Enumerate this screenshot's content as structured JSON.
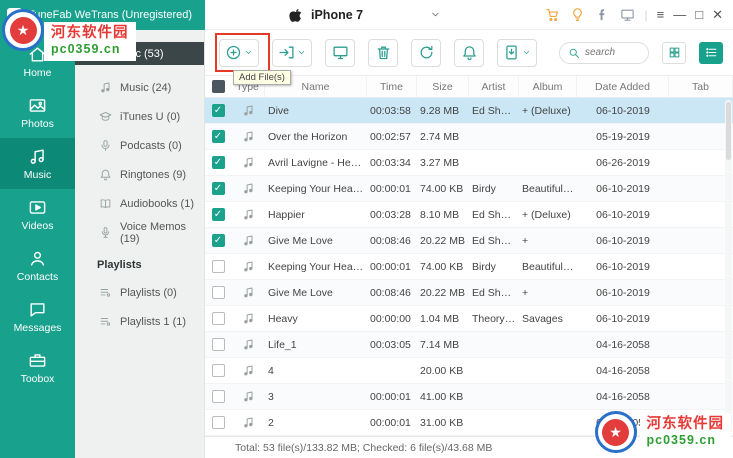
{
  "window": {
    "title": "TuneFab WeTrans (Unregistered)",
    "device": "iPhone 7"
  },
  "sidebar": {
    "items": [
      {
        "label": "Home",
        "icon": "home",
        "active": false
      },
      {
        "label": "Photos",
        "icon": "photos",
        "active": false
      },
      {
        "label": "Music",
        "icon": "music",
        "active": true
      },
      {
        "label": "Videos",
        "icon": "videos",
        "active": false
      },
      {
        "label": "Contacts",
        "icon": "contacts",
        "active": false
      },
      {
        "label": "Messages",
        "icon": "messages",
        "active": false
      },
      {
        "label": "Toobox",
        "icon": "toolbox",
        "active": false
      }
    ]
  },
  "library": {
    "header": "All Music (53)",
    "items": [
      {
        "label": "Music (24)",
        "icon": "note"
      },
      {
        "label": "iTunes U (0)",
        "icon": "itunes-u"
      },
      {
        "label": "Podcasts (0)",
        "icon": "podcast"
      },
      {
        "label": "Ringtones (9)",
        "icon": "ringtone"
      },
      {
        "label": "Audiobooks (1)",
        "icon": "audiobook"
      },
      {
        "label": "Voice Memos (19)",
        "icon": "voice-memo"
      }
    ],
    "playlists_header": "Playlists",
    "playlists": [
      {
        "label": "Playlists (0)",
        "icon": "playlist"
      },
      {
        "label": "Playlists 1 (1)",
        "icon": "playlist"
      }
    ]
  },
  "toolbar": {
    "buttons": [
      {
        "name": "add-file",
        "icon": "add-circle",
        "has_chevron": true
      },
      {
        "name": "export",
        "icon": "export",
        "has_chevron": true
      },
      {
        "name": "transfer-to-device",
        "icon": "monitor",
        "has_chevron": false
      },
      {
        "name": "delete",
        "icon": "trash",
        "has_chevron": false
      },
      {
        "name": "refresh",
        "icon": "sync",
        "has_chevron": false
      },
      {
        "name": "ringtone-maker",
        "icon": "bell",
        "has_chevron": false
      },
      {
        "name": "backup",
        "icon": "backup",
        "has_chevron": true
      }
    ],
    "tooltip": "Add File(s)",
    "search_placeholder": "search"
  },
  "table": {
    "columns": [
      "Type",
      "Name",
      "Time",
      "Size",
      "Artist",
      "Album",
      "Date Added",
      "Tab"
    ],
    "rows": [
      {
        "checked": true,
        "selected": true,
        "name": "Dive",
        "time": "00:03:58",
        "size": "9.28 MB",
        "artist": "Ed Sheeran",
        "album": "+ (Deluxe)",
        "date": "06-10-2019",
        "tab": ""
      },
      {
        "checked": true,
        "selected": false,
        "name": "Over the Horizon",
        "time": "00:02:57",
        "size": "2.74 MB",
        "artist": "",
        "album": "",
        "date": "05-19-2019",
        "tab": ""
      },
      {
        "checked": true,
        "selected": false,
        "name": "Avril Lavigne - Here's To...",
        "time": "00:03:34",
        "size": "3.27 MB",
        "artist": "",
        "album": "",
        "date": "06-26-2019",
        "tab": ""
      },
      {
        "checked": true,
        "selected": false,
        "name": "Keeping Your Head Up",
        "time": "00:00:01",
        "size": "74.00 KB",
        "artist": "Birdy",
        "album": "Beautiful L...",
        "date": "06-10-2019",
        "tab": ""
      },
      {
        "checked": true,
        "selected": false,
        "name": "Happier",
        "time": "00:03:28",
        "size": "8.10 MB",
        "artist": "Ed Sheeran",
        "album": "+ (Deluxe)",
        "date": "06-10-2019",
        "tab": ""
      },
      {
        "checked": true,
        "selected": false,
        "name": "Give Me Love",
        "time": "00:08:46",
        "size": "20.22 MB",
        "artist": "Ed Sheeran",
        "album": "+",
        "date": "06-10-2019",
        "tab": ""
      },
      {
        "checked": false,
        "selected": false,
        "name": "Keeping Your Head Up",
        "time": "00:00:01",
        "size": "74.00 KB",
        "artist": "Birdy",
        "album": "Beautiful L...",
        "date": "06-10-2019",
        "tab": ""
      },
      {
        "checked": false,
        "selected": false,
        "name": "Give Me Love",
        "time": "00:08:46",
        "size": "20.22 MB",
        "artist": "Ed Sheeran",
        "album": "+",
        "date": "06-10-2019",
        "tab": ""
      },
      {
        "checked": false,
        "selected": false,
        "name": "Heavy",
        "time": "00:00:00",
        "size": "1.04 MB",
        "artist": "Theory of ...",
        "album": "Savages",
        "date": "06-10-2019",
        "tab": ""
      },
      {
        "checked": false,
        "selected": false,
        "name": "Life_1",
        "time": "00:03:05",
        "size": "7.14 MB",
        "artist": "",
        "album": "",
        "date": "04-16-2058",
        "tab": ""
      },
      {
        "checked": false,
        "selected": false,
        "name": "4",
        "time": "",
        "size": "20.00 KB",
        "artist": "",
        "album": "",
        "date": "04-16-2058",
        "tab": ""
      },
      {
        "checked": false,
        "selected": false,
        "name": "3",
        "time": "00:00:01",
        "size": "41.00 KB",
        "artist": "",
        "album": "",
        "date": "04-16-2058",
        "tab": ""
      },
      {
        "checked": false,
        "selected": false,
        "name": "2",
        "time": "00:00:01",
        "size": "31.00 KB",
        "artist": "",
        "album": "",
        "date": "04-16-2058",
        "tab": ""
      }
    ]
  },
  "status": {
    "text": "Total: 53 file(s)/133.82 MB; Checked: 6 file(s)/43.68 MB"
  },
  "watermark": {
    "site": "河东软件园",
    "url": "pc0359.cn"
  }
}
